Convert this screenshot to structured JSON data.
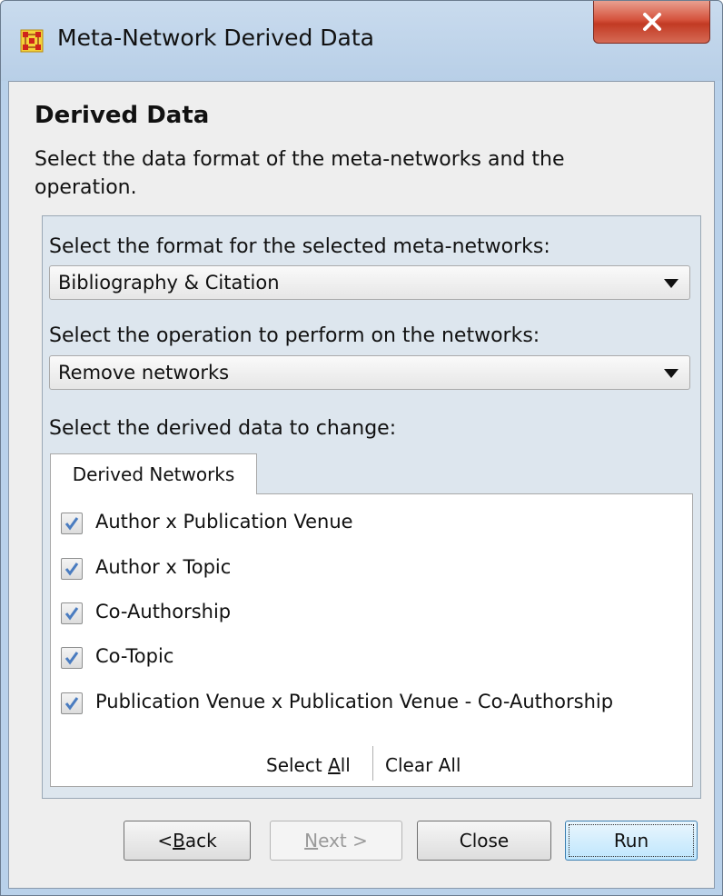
{
  "window": {
    "title": "Meta-Network Derived Data",
    "icon": "grid-network-icon",
    "close_glyph": "X"
  },
  "header": {
    "heading": "Derived Data",
    "description": "Select the data format of the meta-networks and the operation."
  },
  "form": {
    "format_label": "Select the format for the selected meta-networks:",
    "format_value": "Bibliography & Citation",
    "operation_label": "Select the operation to perform on the networks:",
    "operation_value": "Remove networks",
    "derived_label": "Select the derived data to change:"
  },
  "tabs": [
    {
      "label": "Derived Networks",
      "selected": true
    }
  ],
  "networks": [
    {
      "label": "Author x Publication Venue",
      "checked": true
    },
    {
      "label": "Author x Topic",
      "checked": true
    },
    {
      "label": "Co-Authorship",
      "checked": true
    },
    {
      "label": "Co-Topic",
      "checked": true
    },
    {
      "label": "Publication Venue x Publication Venue - Co-Authorship",
      "checked": true
    }
  ],
  "selection": {
    "select_all_prefix": "Select ",
    "select_all_mnemonic": "A",
    "select_all_suffix": "ll",
    "clear_all": "Clear All"
  },
  "buttons": {
    "back_prefix": "< ",
    "back_mnemonic": "B",
    "back_suffix": "ack",
    "next_mnemonic": "N",
    "next_suffix": "ext >",
    "close": "Close",
    "run": "Run"
  },
  "colors": {
    "title_bar": "#b9d1ea",
    "close_button": "#c9432c",
    "checkmark": "#4a7cc0",
    "dialog_bg": "#eeeeee",
    "group_bg": "#dde6ee"
  }
}
